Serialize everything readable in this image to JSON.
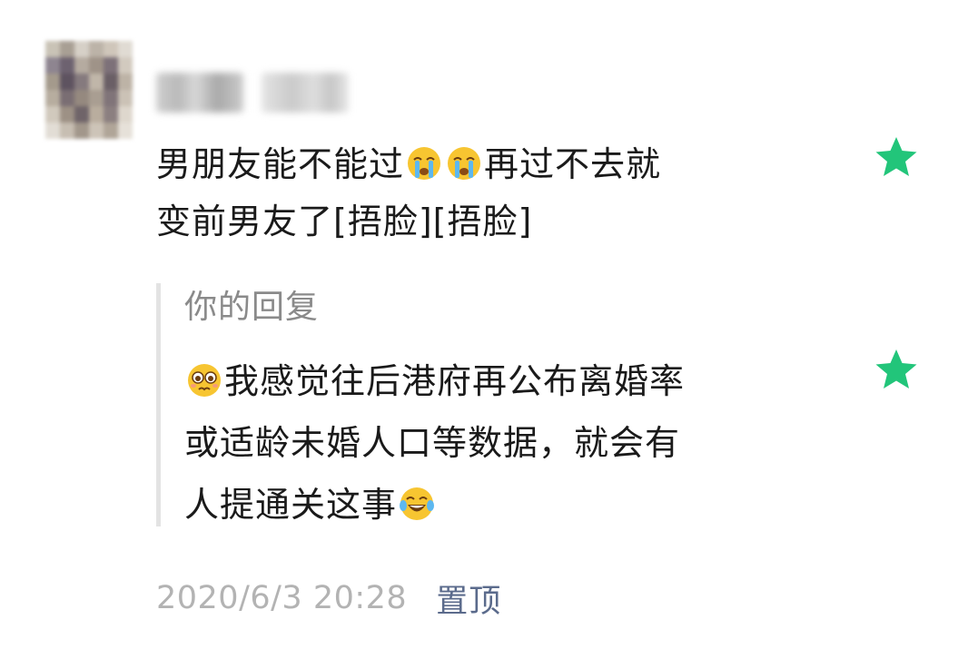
{
  "comment": {
    "author_name_obscured": true,
    "line1_parts": [
      "男朋友能不能过",
      "再过不去就"
    ],
    "line1_emojis": [
      "crying-emoji",
      "crying-emoji"
    ],
    "line2": "变前男友了[捂脸][捂脸]",
    "starred": true
  },
  "reply": {
    "label": "你的回复",
    "emoji_start": "pleading-emoji",
    "line1": "我感觉往后港府再公布离婚率",
    "line2": "或适龄未婚人口等数据，就会有",
    "line3": "人提通关这事",
    "emoji_end": "tears-of-joy-emoji",
    "starred": true
  },
  "meta": {
    "timestamp": "2020/6/3 20:28",
    "pin_label": "置顶"
  },
  "colors": {
    "star": "#22c57a",
    "text": "#1a1a1a",
    "muted": "#8a8a8a",
    "timestamp": "#b3b3b3",
    "link": "#5b6b8c",
    "reply_bar": "#e3e3e3"
  }
}
